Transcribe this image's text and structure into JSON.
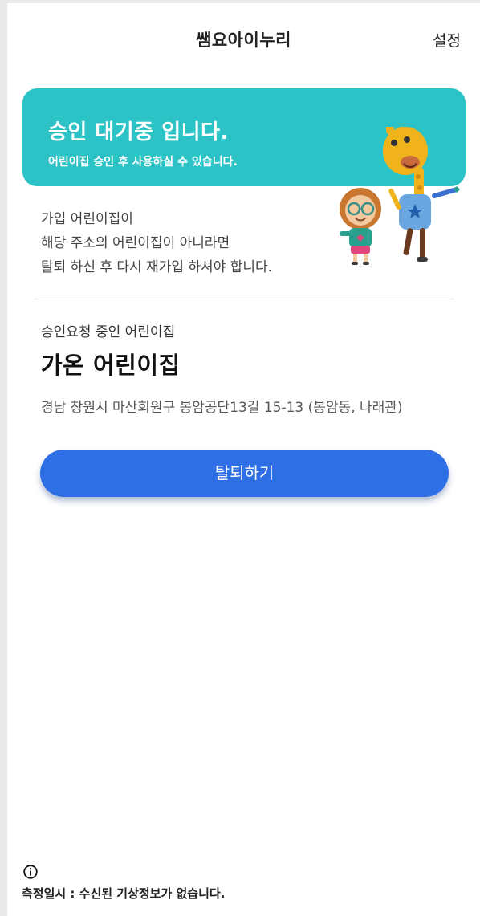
{
  "header": {
    "title": "쌤요아이누리",
    "settings_label": "설정"
  },
  "banner": {
    "title": "승인 대기중 입니다.",
    "subtitle": "어린이집 승인 후 사용하실 수 있습니다."
  },
  "notice": {
    "lines": [
      "가입 어린이집이",
      "해당 주소의 어린이집이 아니라면",
      "탈퇴 하신 후 다시 재가입 하셔야 합니다."
    ]
  },
  "request": {
    "label": "승인요청 중인 어린이집",
    "name": "가온 어린이집",
    "address": "경남 창원시 마산회원구 봉암공단13길 15-13 (봉암동, 나래관)"
  },
  "actions": {
    "withdraw_label": "탈퇴하기"
  },
  "footer": {
    "info_icon": "info-circle-icon",
    "measure_text": "측정일시 : 수신된 기상정보가 없습니다."
  },
  "colors": {
    "banner": "#2cc3c6",
    "primary_button": "#2f6fe6",
    "background": "#ffffff"
  }
}
